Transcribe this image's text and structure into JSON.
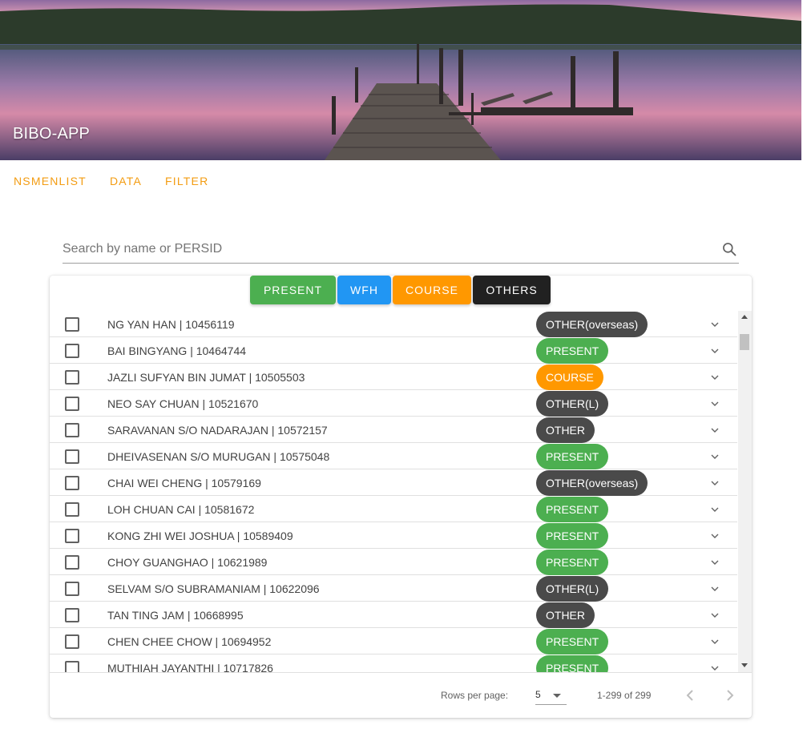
{
  "app": {
    "title": "BIBO-APP"
  },
  "tabs": [
    {
      "label": "NSMENLIST"
    },
    {
      "label": "DATA"
    },
    {
      "label": "FILTER"
    }
  ],
  "search": {
    "placeholder": "Search by name or PERSID",
    "value": ""
  },
  "filters": [
    {
      "label": "PRESENT",
      "color": "#4caf50"
    },
    {
      "label": "WFH",
      "color": "#2196f3"
    },
    {
      "label": "COURSE",
      "color": "#ff9800"
    },
    {
      "label": "OTHERS",
      "color": "#212121"
    }
  ],
  "status_colors": {
    "PRESENT": "#4caf50",
    "COURSE": "#ff9800",
    "OTHER": "#4a4a4a",
    "OTHER(L)": "#4a4a4a",
    "OTHER(overseas)": "#4a4a4a"
  },
  "rows": [
    {
      "name": "NG YAN HAN | 10456119",
      "status": "OTHER(overseas)"
    },
    {
      "name": "BAI BINGYANG | 10464744",
      "status": "PRESENT"
    },
    {
      "name": "JAZLI SUFYAN BIN JUMAT | 10505503",
      "status": "COURSE"
    },
    {
      "name": "NEO SAY CHUAN | 10521670",
      "status": "OTHER(L)"
    },
    {
      "name": "SARAVANAN S/O NADARAJAN | 10572157",
      "status": "OTHER"
    },
    {
      "name": "DHEIVASENAN S/O MURUGAN | 10575048",
      "status": "PRESENT"
    },
    {
      "name": "CHAI WEI CHENG | 10579169",
      "status": "OTHER(overseas)"
    },
    {
      "name": "LOH CHUAN CAI | 10581672",
      "status": "PRESENT"
    },
    {
      "name": "KONG ZHI WEI JOSHUA | 10589409",
      "status": "PRESENT"
    },
    {
      "name": "CHOY GUANGHAO | 10621989",
      "status": "PRESENT"
    },
    {
      "name": "SELVAM S/O SUBRAMANIAM | 10622096",
      "status": "OTHER(L)"
    },
    {
      "name": "TAN TING JAM | 10668995",
      "status": "OTHER"
    },
    {
      "name": "CHEN CHEE CHOW | 10694952",
      "status": "PRESENT"
    },
    {
      "name": "MUTHIAH JAYANTHI | 10717826",
      "status": "PRESENT"
    }
  ],
  "pagination": {
    "rows_per_page_label": "Rows per page:",
    "rows_per_page": "5",
    "range": "1-299 of 299"
  },
  "icons": {
    "search": "search-icon",
    "expand": "chevron-down-icon",
    "prev": "chevron-left-icon",
    "next": "chevron-right-icon"
  }
}
